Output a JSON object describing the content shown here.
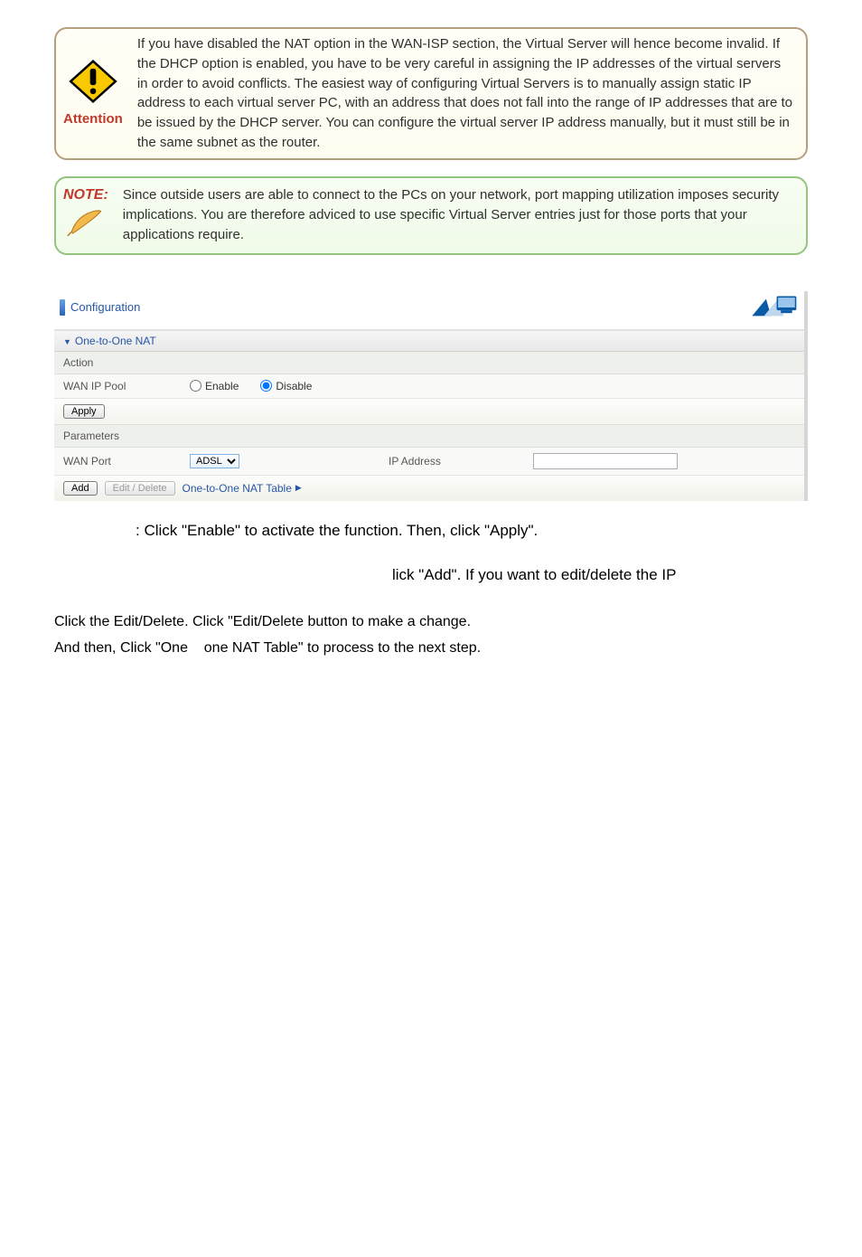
{
  "callouts": {
    "attention": {
      "label": "Attention",
      "text": "If you have disabled the NAT option in the WAN-ISP section, the Virtual Server will hence become invalid. If the DHCP option is enabled, you have to be very careful in assigning the IP addresses of the virtual servers in order to avoid conflicts. The easiest way of configuring Virtual Servers is to manually assign static IP address to each virtual server PC, with an address that does not fall into the range of IP addresses that are to be issued by the DHCP server. You can configure the virtual server IP address manually, but it must still be in the same subnet as the router."
    },
    "note": {
      "label": "NOTE:",
      "text": "Since outside users are able to connect to the PCs on your network, port mapping utilization imposes security implications. You are therefore adviced to use specific Virtual Server entries just for those ports that your applications require."
    }
  },
  "router": {
    "header_title": "Configuration",
    "section_title": "One-to-One NAT",
    "action_label": "Action",
    "wan_ip_pool_label": "WAN IP Pool",
    "enable_label": "Enable",
    "disable_label": "Disable",
    "apply_label": "Apply",
    "parameters_label": "Parameters",
    "wan_port_label": "WAN Port",
    "wan_port_option": "ADSL",
    "ip_address_label": "IP Address",
    "ip_address_value": "",
    "add_label": "Add",
    "edit_delete_label": "Edit / Delete",
    "nat_table_link": "One-to-One NAT Table"
  },
  "doc": {
    "line1": ": Click \"Enable\" to activate the function. Then, click \"Apply\".",
    "line2": "lick \"Add\". If you want to edit/delete the IP",
    "line3a": "Click the Edit/Delete. Click \"Edit/Delete button to make a change.",
    "line3b": "And then, Click \"One",
    "line3c": "one NAT Table\" to process to the next step."
  }
}
